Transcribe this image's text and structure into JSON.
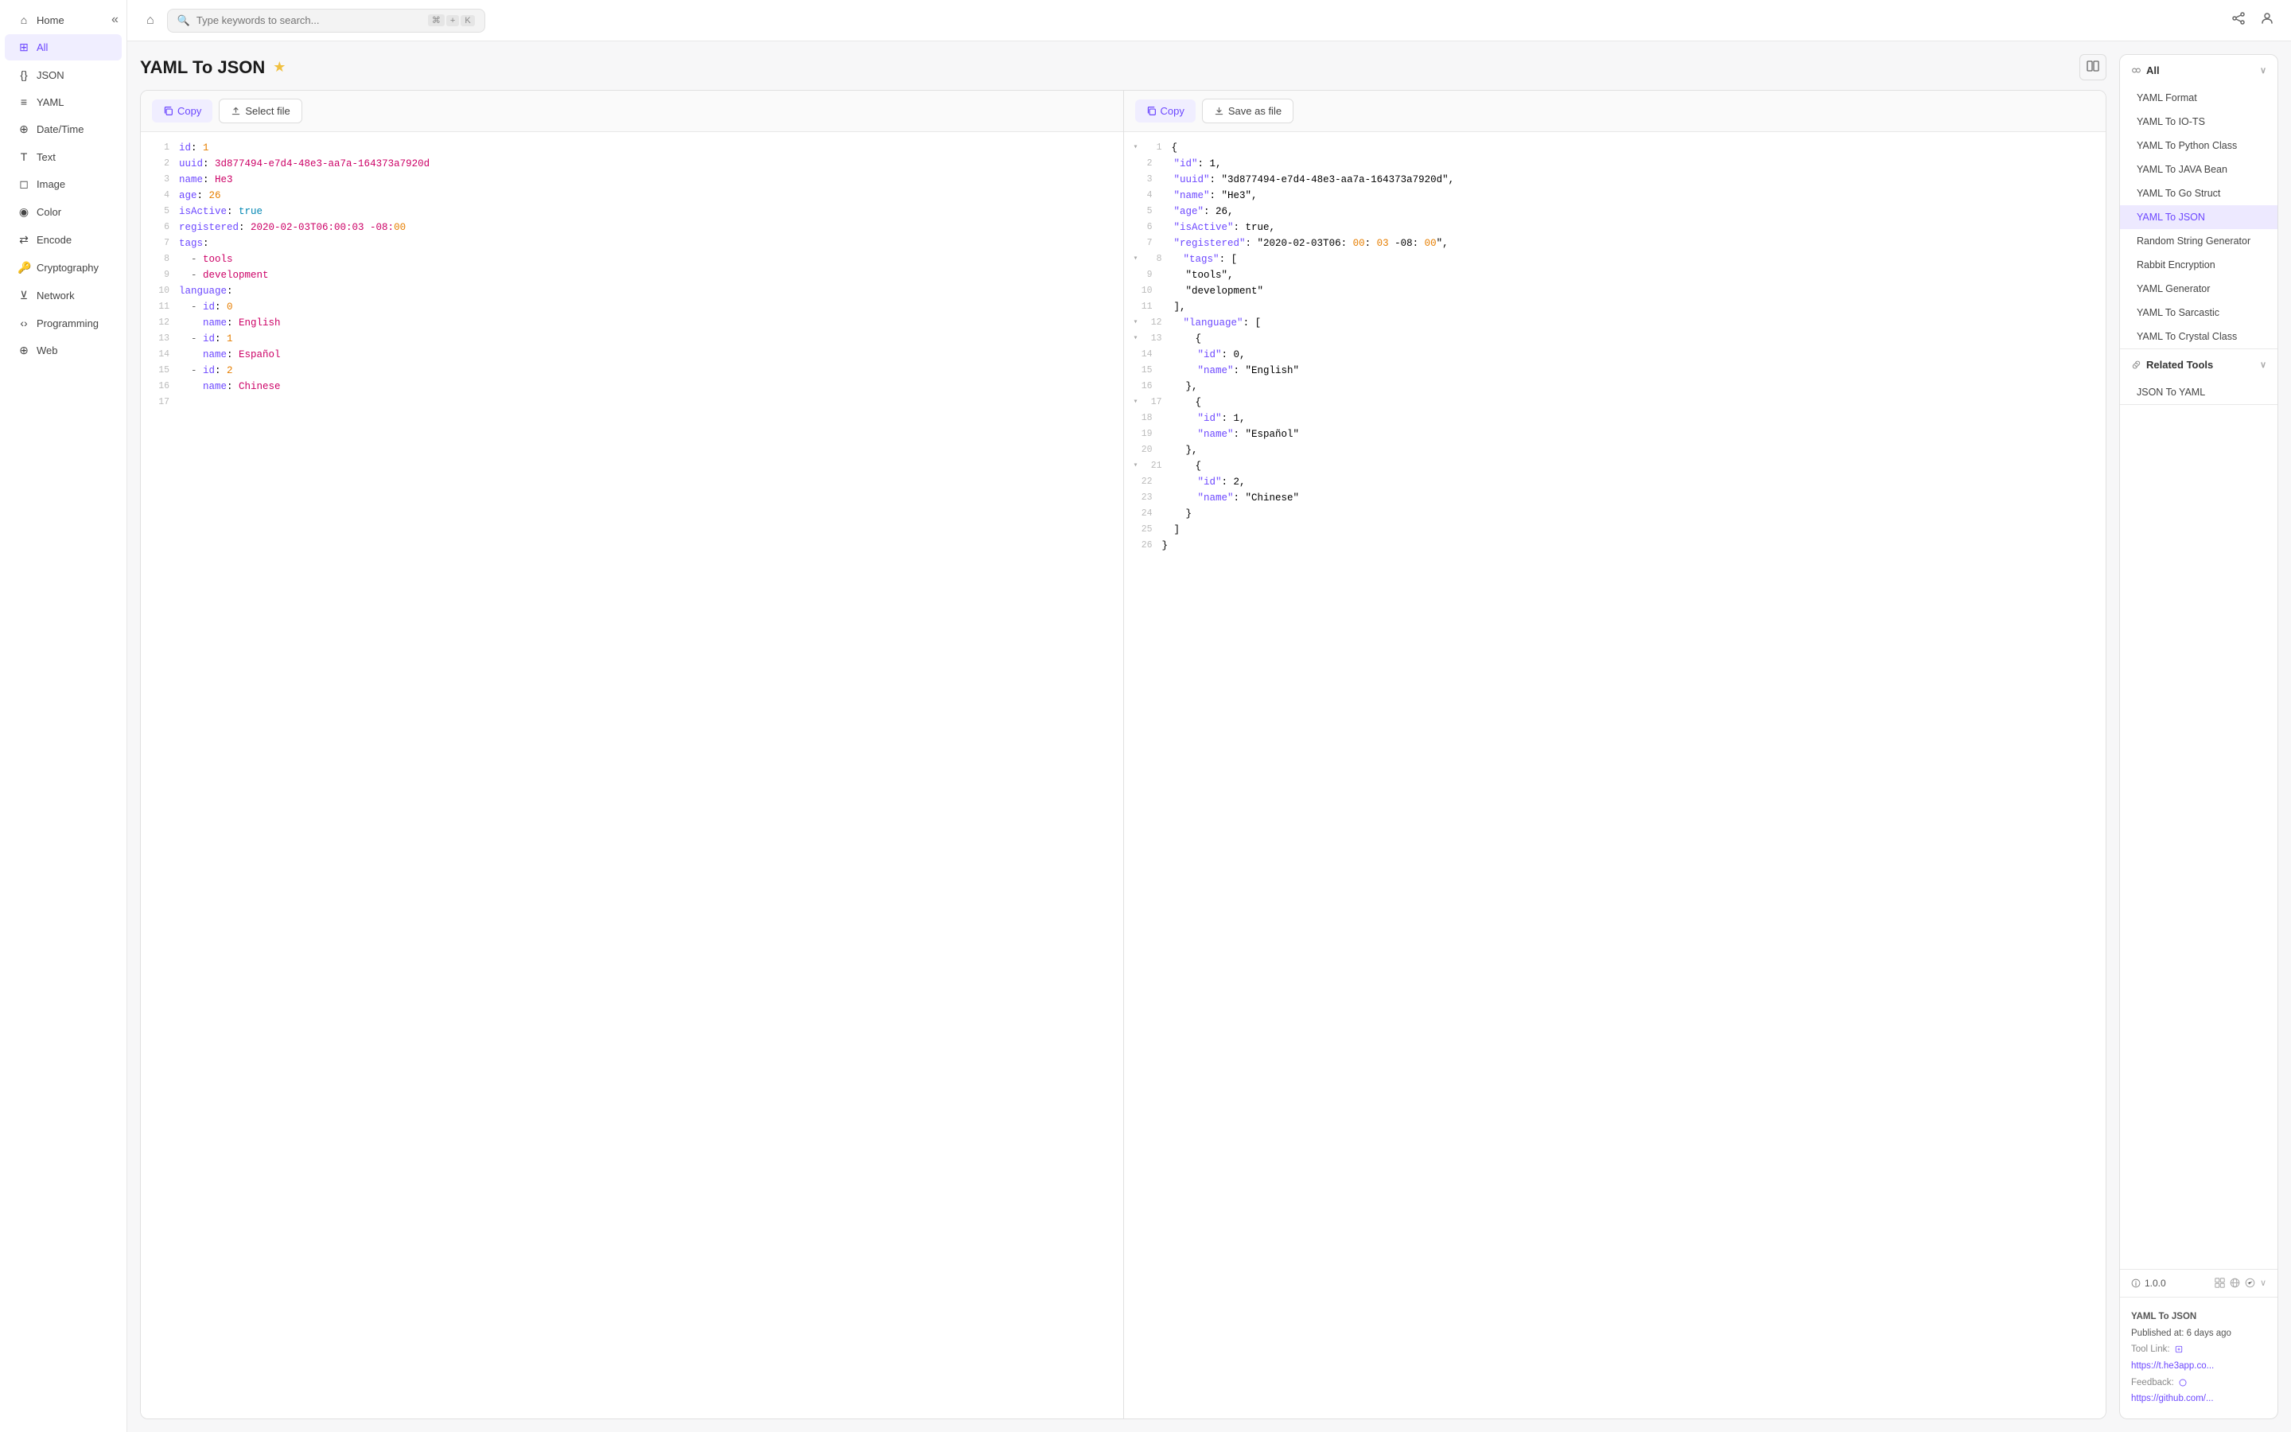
{
  "sidebar": {
    "collapse_icon": "«",
    "items": [
      {
        "id": "home",
        "label": "Home",
        "icon": "⌂",
        "active": false
      },
      {
        "id": "all",
        "label": "All",
        "icon": "⊞",
        "active": true
      },
      {
        "id": "json",
        "label": "JSON",
        "icon": "{ }",
        "active": false
      },
      {
        "id": "yaml",
        "label": "YAML",
        "icon": "≡",
        "active": false
      },
      {
        "id": "datetime",
        "label": "Date/Time",
        "icon": "📅",
        "active": false
      },
      {
        "id": "text",
        "label": "Text",
        "icon": "T",
        "active": false
      },
      {
        "id": "image",
        "label": "Image",
        "icon": "🖼",
        "active": false
      },
      {
        "id": "color",
        "label": "Color",
        "icon": "🎨",
        "active": false
      },
      {
        "id": "encode",
        "label": "Encode",
        "icon": "🔗",
        "active": false
      },
      {
        "id": "cryptography",
        "label": "Cryptography",
        "icon": "🔑",
        "active": false
      },
      {
        "id": "network",
        "label": "Network",
        "icon": "📡",
        "active": false
      },
      {
        "id": "programming",
        "label": "Programming",
        "icon": "💻",
        "active": false
      },
      {
        "id": "web",
        "label": "Web",
        "icon": "🌐",
        "active": false
      }
    ]
  },
  "topbar": {
    "home_icon": "⌂",
    "search_placeholder": "Type keywords to search...",
    "search_shortcut": "⌘+K",
    "share_icon": "share",
    "user_icon": "user"
  },
  "tool": {
    "title": "YAML To JSON",
    "star_icon": "★",
    "split_icon": "⊟"
  },
  "left_panel": {
    "copy_label": "Copy",
    "select_file_label": "Select file",
    "lines": [
      {
        "num": 1,
        "content": "id: 1",
        "tokens": [
          {
            "t": "key",
            "v": "id"
          },
          {
            "t": "punct",
            "v": ": "
          },
          {
            "t": "num",
            "v": "1"
          }
        ]
      },
      {
        "num": 2,
        "content": "uuid: 3d877494-e7d4-48e3-aa7a-164373a7920d",
        "tokens": [
          {
            "t": "key",
            "v": "uuid"
          },
          {
            "t": "punct",
            "v": ": "
          },
          {
            "t": "str",
            "v": "3d877494-e7d4-48e3-aa7a-164373a7920d"
          }
        ]
      },
      {
        "num": 3,
        "content": "name: He3",
        "tokens": [
          {
            "t": "key",
            "v": "name"
          },
          {
            "t": "punct",
            "v": ": "
          },
          {
            "t": "str",
            "v": "He3"
          }
        ]
      },
      {
        "num": 4,
        "content": "age: 26",
        "tokens": [
          {
            "t": "key",
            "v": "age"
          },
          {
            "t": "punct",
            "v": ": "
          },
          {
            "t": "num",
            "v": "26"
          }
        ]
      },
      {
        "num": 5,
        "content": "isActive: true",
        "tokens": [
          {
            "t": "key",
            "v": "isActive"
          },
          {
            "t": "punct",
            "v": ": "
          },
          {
            "t": "bool",
            "v": "true"
          }
        ]
      },
      {
        "num": 6,
        "content": "registered: 2020-02-03T06:00:03 -08:00",
        "tokens": [
          {
            "t": "key",
            "v": "registered"
          },
          {
            "t": "punct",
            "v": ": "
          },
          {
            "t": "str",
            "v": "2020-02-03T06:00:03 -08:"
          },
          {
            "t": "num",
            "v": "00"
          }
        ]
      },
      {
        "num": 7,
        "content": "tags:",
        "tokens": [
          {
            "t": "key",
            "v": "tags"
          },
          {
            "t": "punct",
            "v": ":"
          }
        ]
      },
      {
        "num": 8,
        "content": "  - tools",
        "tokens": [
          {
            "t": "dash",
            "v": "  - "
          },
          {
            "t": "str",
            "v": "tools"
          }
        ]
      },
      {
        "num": 9,
        "content": "  - development",
        "tokens": [
          {
            "t": "dash",
            "v": "  - "
          },
          {
            "t": "str",
            "v": "development"
          }
        ]
      },
      {
        "num": 10,
        "content": "language:",
        "tokens": [
          {
            "t": "key",
            "v": "language"
          },
          {
            "t": "punct",
            "v": ":"
          }
        ]
      },
      {
        "num": 11,
        "content": "  - id: 0",
        "tokens": [
          {
            "t": "dash",
            "v": "  - "
          },
          {
            "t": "key",
            "v": "id"
          },
          {
            "t": "punct",
            "v": ": "
          },
          {
            "t": "num",
            "v": "0"
          }
        ]
      },
      {
        "num": 12,
        "content": "    name: English",
        "tokens": [
          {
            "t": "indent",
            "v": "    "
          },
          {
            "t": "key",
            "v": "name"
          },
          {
            "t": "punct",
            "v": ": "
          },
          {
            "t": "str",
            "v": "English"
          }
        ]
      },
      {
        "num": 13,
        "content": "  - id: 1",
        "tokens": [
          {
            "t": "dash",
            "v": "  - "
          },
          {
            "t": "key",
            "v": "id"
          },
          {
            "t": "punct",
            "v": ": "
          },
          {
            "t": "num",
            "v": "1"
          }
        ]
      },
      {
        "num": 14,
        "content": "    name: Español",
        "tokens": [
          {
            "t": "indent",
            "v": "    "
          },
          {
            "t": "key",
            "v": "name"
          },
          {
            "t": "punct",
            "v": ": "
          },
          {
            "t": "str",
            "v": "Español"
          }
        ]
      },
      {
        "num": 15,
        "content": "  - id: 2",
        "tokens": [
          {
            "t": "dash",
            "v": "  - "
          },
          {
            "t": "key",
            "v": "id"
          },
          {
            "t": "punct",
            "v": ": "
          },
          {
            "t": "num",
            "v": "2"
          }
        ]
      },
      {
        "num": 16,
        "content": "    name: Chinese",
        "tokens": [
          {
            "t": "indent",
            "v": "    "
          },
          {
            "t": "key",
            "v": "name"
          },
          {
            "t": "punct",
            "v": ": "
          },
          {
            "t": "str",
            "v": "Chinese"
          }
        ]
      },
      {
        "num": 17,
        "content": "",
        "tokens": []
      }
    ]
  },
  "right_panel_editor": {
    "copy_label": "Copy",
    "save_label": "Save as file",
    "lines": [
      {
        "num": 1,
        "content": "{",
        "collapsible": true
      },
      {
        "num": 2,
        "content": "  \"id\": 1,",
        "indent": 1
      },
      {
        "num": 3,
        "content": "  \"uuid\": \"3d877494-e7d4-48e3-aa7a-164373a7920d\",",
        "indent": 1
      },
      {
        "num": 4,
        "content": "  \"name\": \"He3\",",
        "indent": 1
      },
      {
        "num": 5,
        "content": "  \"age\": 26,",
        "indent": 1
      },
      {
        "num": 6,
        "content": "  \"isActive\": true,",
        "indent": 1
      },
      {
        "num": 7,
        "content": "  \"registered\": \"2020-02-03T06:00:03 -08:00\",",
        "indent": 1
      },
      {
        "num": 8,
        "content": "  \"tags\": [",
        "indent": 1,
        "collapsible": true
      },
      {
        "num": 9,
        "content": "    \"tools\",",
        "indent": 2
      },
      {
        "num": 10,
        "content": "    \"development\"",
        "indent": 2
      },
      {
        "num": 11,
        "content": "  ],",
        "indent": 1
      },
      {
        "num": 12,
        "content": "  \"language\": [",
        "indent": 1,
        "collapsible": true
      },
      {
        "num": 13,
        "content": "    {",
        "indent": 2,
        "collapsible": true
      },
      {
        "num": 14,
        "content": "      \"id\": 0,",
        "indent": 3
      },
      {
        "num": 15,
        "content": "      \"name\": \"English\"",
        "indent": 3
      },
      {
        "num": 16,
        "content": "    },",
        "indent": 2
      },
      {
        "num": 17,
        "content": "    {",
        "indent": 2,
        "collapsible": true
      },
      {
        "num": 18,
        "content": "      \"id\": 1,",
        "indent": 3
      },
      {
        "num": 19,
        "content": "      \"name\": \"Español\"",
        "indent": 3
      },
      {
        "num": 20,
        "content": "    },",
        "indent": 2
      },
      {
        "num": 21,
        "content": "    {",
        "indent": 2,
        "collapsible": true
      },
      {
        "num": 22,
        "content": "      \"id\": 2,",
        "indent": 3
      },
      {
        "num": 23,
        "content": "      \"name\": \"Chinese\"",
        "indent": 3
      },
      {
        "num": 24,
        "content": "    }",
        "indent": 2
      },
      {
        "num": 25,
        "content": "  ]",
        "indent": 1
      },
      {
        "num": 26,
        "content": "}",
        "indent": 0
      }
    ]
  },
  "sidebar_right": {
    "all_section": {
      "label": "All",
      "expanded": true,
      "items": [
        {
          "id": "yaml-format",
          "label": "YAML Format",
          "active": false
        },
        {
          "id": "yaml-to-io-ts",
          "label": "YAML To IO-TS",
          "active": false
        },
        {
          "id": "yaml-to-python-class",
          "label": "YAML To Python Class",
          "active": false
        },
        {
          "id": "yaml-to-java-bean",
          "label": "YAML To JAVA Bean",
          "active": false
        },
        {
          "id": "yaml-to-go-struct",
          "label": "YAML To Go Struct",
          "active": false
        },
        {
          "id": "yaml-to-json",
          "label": "YAML To JSON",
          "active": true
        },
        {
          "id": "random-string-generator",
          "label": "Random String Generator",
          "active": false
        },
        {
          "id": "rabbit-encryption",
          "label": "Rabbit Encryption",
          "active": false
        },
        {
          "id": "yaml-generator",
          "label": "YAML Generator",
          "active": false
        },
        {
          "id": "yaml-to-sarcastic",
          "label": "YAML To Sarcastic",
          "active": false
        },
        {
          "id": "yaml-to-crystal-class",
          "label": "YAML To Crystal Class",
          "active": false
        }
      ]
    },
    "related_tools": {
      "label": "Related Tools",
      "expanded": true,
      "items": [
        {
          "id": "json-to-yaml",
          "label": "JSON To YAML",
          "active": false
        }
      ]
    },
    "version_info": {
      "version": "1.0.0",
      "tool_name": "YAML To JSON",
      "published": "Published at: 6 days ago",
      "tool_link_label": "Tool Link:",
      "tool_link_url": "https://t.he3app.co...",
      "feedback_label": "Feedback:",
      "feedback_url": "https://github.com/..."
    }
  }
}
